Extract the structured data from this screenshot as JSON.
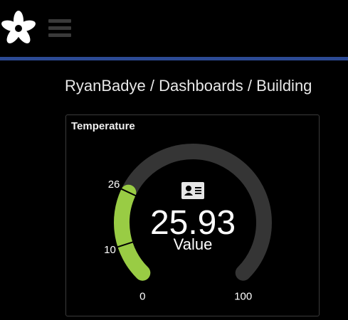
{
  "breadcrumb": {
    "user": "RyanBadye",
    "section": "Dashboards",
    "dashboard": "Building",
    "separator": "/"
  },
  "block": {
    "title": "Temperature",
    "value": "25.93",
    "value_label": "Value",
    "icon": "id-card-icon",
    "gauge": {
      "min": 0,
      "max": 100,
      "min_label": "0",
      "max_label": "100",
      "marker_low": 10,
      "marker_low_label": "10",
      "marker_high": 26,
      "marker_high_label": "26",
      "current": 25.93
    }
  },
  "colors": {
    "track": "#353535",
    "fill": "#99cc44",
    "header_rule": "#2c4a94",
    "background": "#000000"
  }
}
